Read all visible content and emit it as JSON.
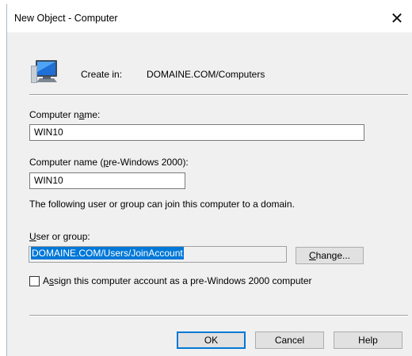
{
  "window": {
    "title": "New Object - Computer",
    "close_glyph": "✕"
  },
  "header": {
    "icon": "computer-icon",
    "create_in_label": "Create in:",
    "create_in_value": "DOMAINE.COM/Computers"
  },
  "form": {
    "computer_name_label": {
      "before": "Computer n",
      "accel": "a",
      "after": "me:"
    },
    "computer_name_value": "WIN10",
    "pre2000_label": {
      "before": "Computer name (",
      "accel": "p",
      "after": "re-Windows 2000):"
    },
    "pre2000_value": "WIN10",
    "join_info_text": "The following user or group can join this computer to a domain.",
    "user_group_label": {
      "before": "",
      "accel": "U",
      "after": "ser or group:"
    },
    "user_group_value": "DOMAINE.COM/Users/JoinAccount",
    "change_button": {
      "before": "",
      "accel": "C",
      "after": "hange..."
    },
    "assign_checkbox_label": {
      "before": "A",
      "accel": "s",
      "after": "sign this computer account as a pre-Windows 2000 computer"
    },
    "assign_checked": false
  },
  "buttons": {
    "ok": "OK",
    "cancel": "Cancel",
    "help": "Help"
  },
  "colors": {
    "dialog_bg": "#f0f0f0",
    "selection": "#0078d7",
    "default_button_border": "#0078d7"
  }
}
